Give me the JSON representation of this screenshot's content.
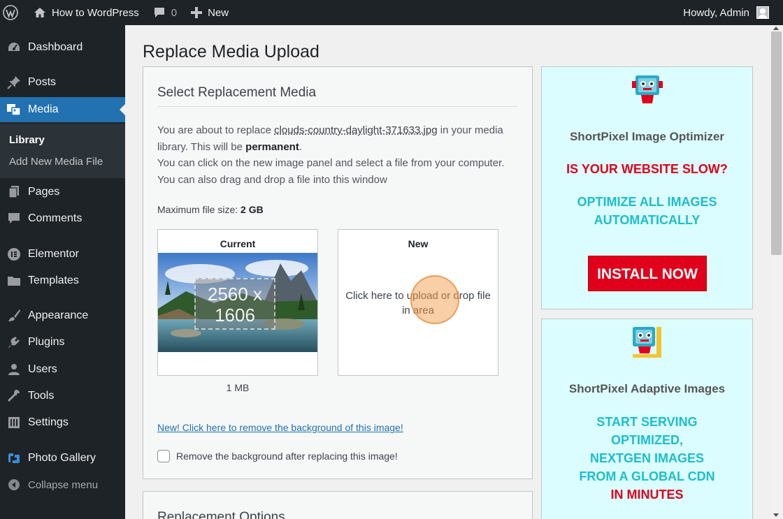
{
  "adminbar": {
    "site_name": "How to WordPress",
    "comments_count": "0",
    "new_label": "New",
    "howdy": "Howdy, Admin"
  },
  "sidebar": {
    "items": [
      {
        "label": "Dashboard",
        "icon": "dashboard-icon"
      },
      {
        "label": "Posts",
        "icon": "pin-icon"
      },
      {
        "label": "Media",
        "icon": "media-icon"
      },
      {
        "label": "Pages",
        "icon": "pages-icon"
      },
      {
        "label": "Comments",
        "icon": "comment-icon"
      },
      {
        "label": "Elementor",
        "icon": "elementor-icon"
      },
      {
        "label": "Templates",
        "icon": "folder-icon"
      },
      {
        "label": "Appearance",
        "icon": "brush-icon"
      },
      {
        "label": "Plugins",
        "icon": "plugin-icon"
      },
      {
        "label": "Users",
        "icon": "user-icon"
      },
      {
        "label": "Tools",
        "icon": "wrench-icon"
      },
      {
        "label": "Settings",
        "icon": "settings-icon"
      },
      {
        "label": "Photo Gallery",
        "icon": "gallery-icon"
      }
    ],
    "submenu": [
      "Library",
      "Add New Media File"
    ],
    "collapse_label": "Collapse menu"
  },
  "main": {
    "page_title": "Replace Media Upload",
    "section_title": "Select Replacement Media",
    "desc_1": "You are about to replace ",
    "filename": "clouds-country-daylight-371633.jpg",
    "desc_2": " in your media library. This will be ",
    "permanent": "permanent",
    "desc_3": ".",
    "desc_4": "You can click on the new image panel and select a file from your computer. You can also drag and drop a file into this window",
    "max_size_label": "Maximum file size: ",
    "max_size_value": "2 GB",
    "current_label": "Current",
    "current_dim_w": "2560 x",
    "current_dim_h": "1606",
    "new_label": "New",
    "new_text": "Click here to upload or drop file in area",
    "file_size": "1 MB",
    "bg_link": "New! Click here to remove the background of this image!",
    "bg_checkbox_label": "Remove the background after replacing this image!",
    "section2_title": "Replacement Options"
  },
  "ads": {
    "ad1": {
      "title": "ShortPixel Image Optimizer",
      "headline": "IS YOUR WEBSITE SLOW?",
      "line1": "OPTIMIZE ALL IMAGES",
      "line2": "AUTOMATICALLY",
      "button": "INSTALL NOW"
    },
    "ad2": {
      "title": "ShortPixel Adaptive Images",
      "line1": "START SERVING",
      "line2": "OPTIMIZED,",
      "line3": "NEXTGEN IMAGES",
      "line4": "FROM A GLOBAL CDN",
      "line5": "IN MINUTES"
    }
  },
  "colors": {
    "adminbar_bg": "#1d2327",
    "accent": "#2271b1",
    "ad_bg": "#dcfdff",
    "ad_red": "#e0001b",
    "ad_teal": "#1cbecb"
  }
}
